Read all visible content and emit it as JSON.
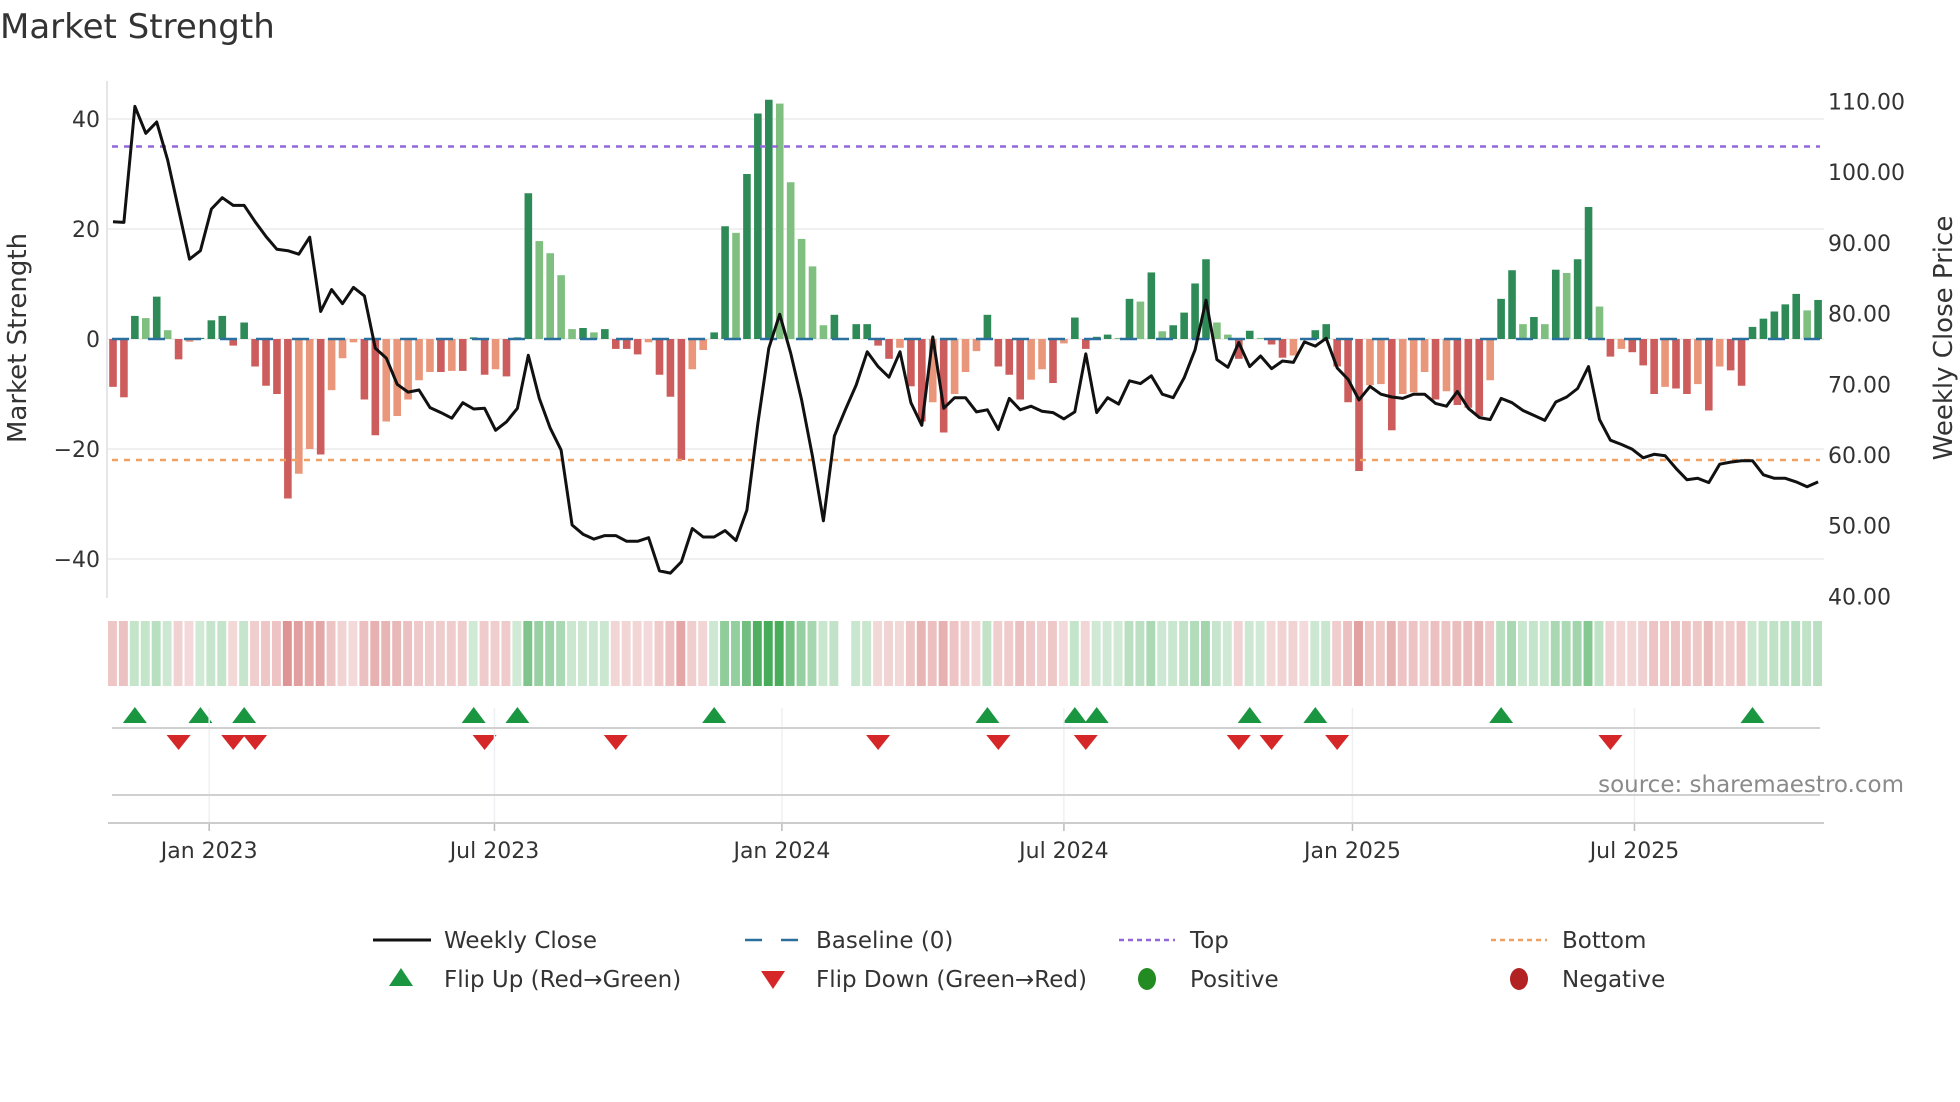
{
  "chart_data": {
    "type": "bar",
    "title": "Market Strength",
    "ylabel": "Market Strength",
    "y2label": "Weekly Close Price",
    "source": "source: sharemaestro.com",
    "ylim": [
      -47,
      47
    ],
    "y2lim": [
      38.8,
      111.2
    ],
    "yticks": [
      40,
      20,
      0,
      -20,
      -40
    ],
    "ytick_labels": [
      "40",
      "20",
      "0",
      "−20",
      "−40"
    ],
    "y2ticks": [
      110,
      100,
      90,
      80,
      70,
      60,
      50,
      40
    ],
    "y2tick_labels": [
      "110.00",
      "100.00",
      "90.00",
      "80.00",
      "70.00",
      "60.00",
      "50.00",
      "40.00"
    ],
    "xticks": [
      {
        "week_index": 8.8,
        "label": "Jan 2023"
      },
      {
        "week_index": 34.9,
        "label": "Jul 2023"
      },
      {
        "week_index": 61.2,
        "label": "Jan 2024"
      },
      {
        "week_index": 87.0,
        "label": "Jul 2024"
      },
      {
        "week_index": 113.4,
        "label": "Jan 2025"
      },
      {
        "week_index": 139.2,
        "label": "Jul 2025"
      }
    ],
    "grid": true,
    "top_level": 35,
    "bottom_level": -22,
    "baseline": 0,
    "strength": [
      -8.7,
      -10.6,
      4.2,
      3.8,
      7.7,
      1.6,
      -3.7,
      -0.5,
      0.2,
      3.4,
      4.2,
      -1.2,
      3.0,
      -5,
      -8.5,
      -10,
      -29,
      -24.5,
      -20,
      -21,
      -9.3,
      -3.5,
      -0.6,
      -11,
      -17.5,
      -15,
      -14,
      -11,
      -7.5,
      -6,
      -6,
      -5.8,
      -5.8,
      0.3,
      -6.5,
      -5.5,
      -6.8,
      0.3,
      26.5,
      17.8,
      15.6,
      11.6,
      1.8,
      2,
      1.2,
      1.8,
      -1.8,
      -1.8,
      -2.8,
      -0.6,
      -6.5,
      -10.5,
      -22,
      -5.5,
      -2,
      1.2,
      20.5,
      19.3,
      30,
      41,
      43.5,
      42.8,
      28.5,
      18.2,
      13.2,
      2.5,
      4.4,
      0,
      2.7,
      2.7,
      -1.2,
      -3.6,
      -1.6,
      -8.6,
      -15,
      -11.5,
      -17,
      -10,
      -6,
      -2.2,
      4.4,
      -5,
      -6.5,
      -11,
      -7.4,
      -5.5,
      -8,
      -0.8,
      3.9,
      -1.8,
      0.4,
      0.8,
      0.2,
      7.3,
      6.8,
      12.1,
      1.4,
      2.5,
      4.8,
      10.1,
      14.5,
      3,
      0.8,
      -3.6,
      1.5,
      0.2,
      -1,
      -3.4,
      -3,
      -0.2,
      1.6,
      2.7,
      -5,
      -11.5,
      -24,
      -8.4,
      -8.2,
      -16.6,
      -10,
      -9.7,
      -6,
      -11,
      -9.5,
      -12,
      -12.5,
      -14,
      -7.5,
      7.3,
      12.5,
      2.7,
      4,
      2.7,
      12.6,
      12,
      14.5,
      24,
      5.9,
      -3.2,
      -1.8,
      -2.4,
      -4.8,
      -10,
      -8.7,
      -9,
      -10,
      -8.2,
      -13,
      -5,
      -5.7,
      -8.5,
      2.2,
      3.7,
      5,
      6.3,
      8.2,
      5.2,
      7.1
    ],
    "weekly_close": [
      93.0,
      92.9,
      109.3,
      105.5,
      107.1,
      101.7,
      94.7,
      87.7,
      88.9,
      94.8,
      96.4,
      95.3,
      95.3,
      93.0,
      90.9,
      89.1,
      88.9,
      88.4,
      90.8,
      80.3,
      83.4,
      81.4,
      83.7,
      82.5,
      75.1,
      73.7,
      70.0,
      68.9,
      69.2,
      66.7,
      66.0,
      65.2,
      67.4,
      66.5,
      66.6,
      63.5,
      64.7,
      66.6,
      74.1,
      68.0,
      63.8,
      60.7,
      50.1,
      48.8,
      48.1,
      48.6,
      48.6,
      47.8,
      47.8,
      48.3,
      43.6,
      43.3,
      44.9,
      49.6,
      48.4,
      48.4,
      49.3,
      47.9,
      52.2,
      64.5,
      75.1,
      79.9,
      74.4,
      67.8,
      59.8,
      50.7,
      62.7,
      66.4,
      69.9,
      74.6,
      72.5,
      71.0,
      74.6,
      67.4,
      64.2,
      76.7,
      66.6,
      68.1,
      68.1,
      66.1,
      66.4,
      63.6,
      68.0,
      66.4,
      66.9,
      66.2,
      66.0,
      65.1,
      66.1,
      74.3,
      66.0,
      68.1,
      67.2,
      70.5,
      70.1,
      71.2,
      68.6,
      68.1,
      70.9,
      74.9,
      81.9,
      73.5,
      72.4,
      75.9,
      72.5,
      74.0,
      72.2,
      73.3,
      73.1,
      76.0,
      75.4,
      76.5,
      72.3,
      70.7,
      67.8,
      69.7,
      68.6,
      68.2,
      68.0,
      68.6,
      68.6,
      67.3,
      66.9,
      69.0,
      66.6,
      65.3,
      65.0,
      68.0,
      67.4,
      66.3,
      65.6,
      64.9,
      67.5,
      68.2,
      69.4,
      72.5,
      65.0,
      62.1,
      61.5,
      60.8,
      59.6,
      60.1,
      59.9,
      58.1,
      56.5,
      56.7,
      56.1,
      58.7,
      59.0,
      59.2,
      59.2,
      57.2,
      56.7,
      56.7,
      56.2,
      55.5,
      56.2
    ],
    "flip_up_weeks": [
      2,
      8,
      12,
      33,
      37,
      55,
      80,
      88,
      90,
      104,
      110,
      127,
      150
    ],
    "flip_down_weeks": [
      6,
      11,
      13,
      34,
      46,
      70,
      81,
      89,
      103,
      106,
      112,
      137
    ],
    "legend": {
      "placement": "bottom",
      "items": [
        {
          "label": "Weekly Close",
          "kind": "line"
        },
        {
          "label": "Baseline (0)",
          "kind": "dash"
        },
        {
          "label": "Top",
          "kind": "dot-purple"
        },
        {
          "label": "Bottom",
          "kind": "dot-orange"
        },
        {
          "label": "Flip Up (Red→Green)",
          "kind": "tri-up"
        },
        {
          "label": "Flip Down (Green→Red)",
          "kind": "tri-down"
        },
        {
          "label": "Positive",
          "kind": "dot-pos"
        },
        {
          "label": "Negative",
          "kind": "dot-neg"
        }
      ]
    },
    "colors": {
      "pos_strong": "#2e8b57",
      "pos_weak": "#7fbf7f",
      "neg_strong": "#cd5c5c",
      "neg_weak": "#e9967a",
      "price": "#111111",
      "baseline": "#2b6f9e",
      "top": "#9467d8",
      "bottom": "#f0a060",
      "flip_up": "#1a9641",
      "flip_down": "#d62728",
      "positive": "#228b22",
      "negative": "#b22222"
    }
  }
}
